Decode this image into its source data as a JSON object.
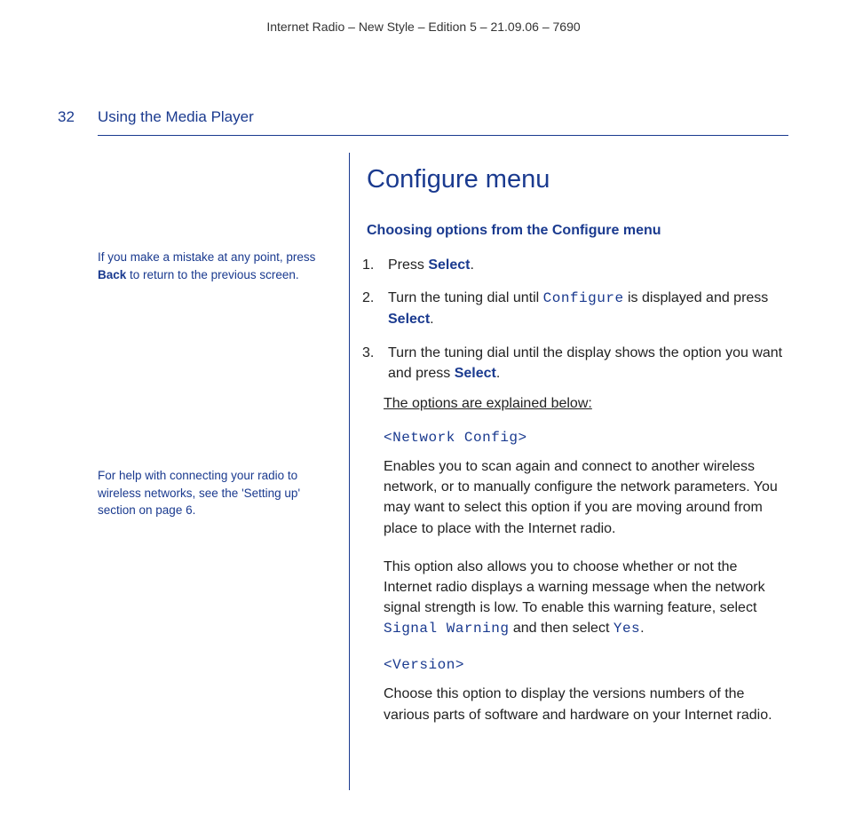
{
  "header": "Internet Radio – New Style – Edition 5 – 21.09.06 – 7690",
  "page_number": "32",
  "section_title": "Using the Media Player",
  "sidebar": {
    "note1_pre": "If you make a mistake at any point, press ",
    "note1_bold": "Back",
    "note1_post": " to return to the previous screen.",
    "note2": "For help with connecting your radio to wireless networks, see the 'Setting up' section on page 6."
  },
  "main": {
    "h1": "Configure menu",
    "h3": "Choosing options from the Configure menu",
    "step1_pre": "Press ",
    "step1_sel": "Select",
    "step1_post": ".",
    "step2_pre": "Turn the tuning dial until ",
    "step2_lcd": "Configure",
    "step2_mid": " is displayed and press ",
    "step2_sel": "Select",
    "step2_post": ".",
    "step3_pre": "Turn the tuning dial until the display shows the option you want and press ",
    "step3_sel": "Select",
    "step3_post": ".",
    "explain": "The options are explained below:",
    "opt1_head": "<Network Config>",
    "opt1_p1": "Enables you to scan again and connect to another wireless network, or to manually configure the network parameters. You may want to select this option if you are moving around from place to place with the Internet radio.",
    "opt1_p2_pre": "This option also allows you to choose whether or not the Internet radio displays a warning message when the network signal strength is low. To enable this warning feature, select ",
    "opt1_p2_lcd1": "Signal Warning",
    "opt1_p2_mid": " and then select ",
    "opt1_p2_lcd2": "Yes",
    "opt1_p2_post": ".",
    "opt2_head": "<Version>",
    "opt2_p": "Choose this option to display the versions numbers of the various parts of software and hardware on your Internet radio."
  }
}
